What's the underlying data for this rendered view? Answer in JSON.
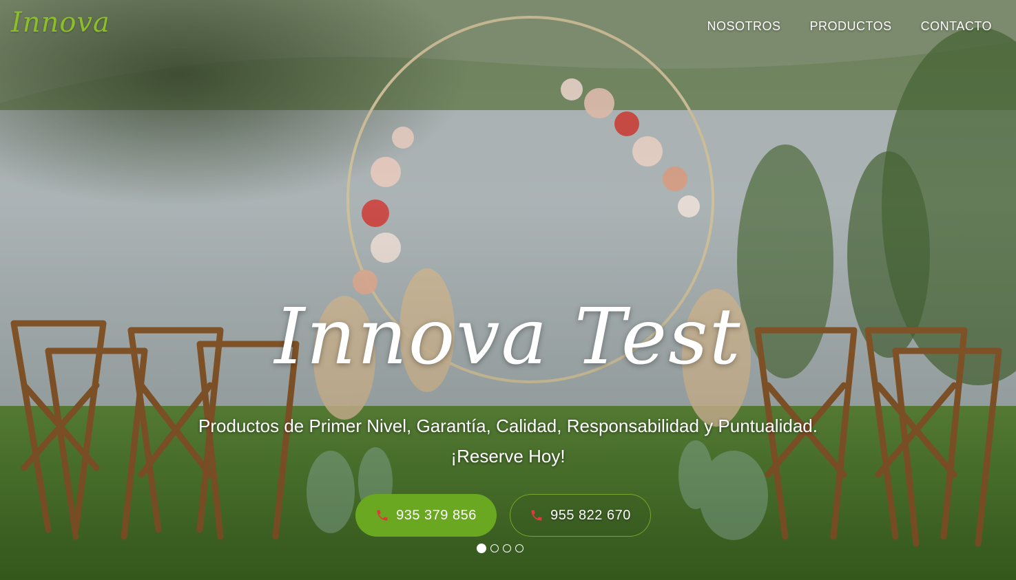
{
  "brand": {
    "logo_text": "Innova",
    "accent_color": "#8cbe2a"
  },
  "nav": {
    "items": [
      "NOSOTROS",
      "PRODUCTOS",
      "CONTACTO"
    ]
  },
  "hero": {
    "title": "Innova Test",
    "subtitle_line1": "Productos de Primer Nivel, Garantía, Calidad, Responsabilidad y Puntualidad.",
    "subtitle_line2": "¡Reserve Hoy!",
    "background_image": "outdoor-wedding-ceremony-flower-arch-chairs-lake-photo"
  },
  "buttons": {
    "primary": {
      "icon": "phone-icon",
      "label": "935 379 856",
      "color": "#6aa821"
    },
    "secondary": {
      "icon": "phone-icon",
      "label": "955 822 670"
    }
  },
  "carousel": {
    "slide_count": 4,
    "active_index": 0
  },
  "colors": {
    "phone_icon": "#e23a3a",
    "button_green": "#6aa821"
  }
}
